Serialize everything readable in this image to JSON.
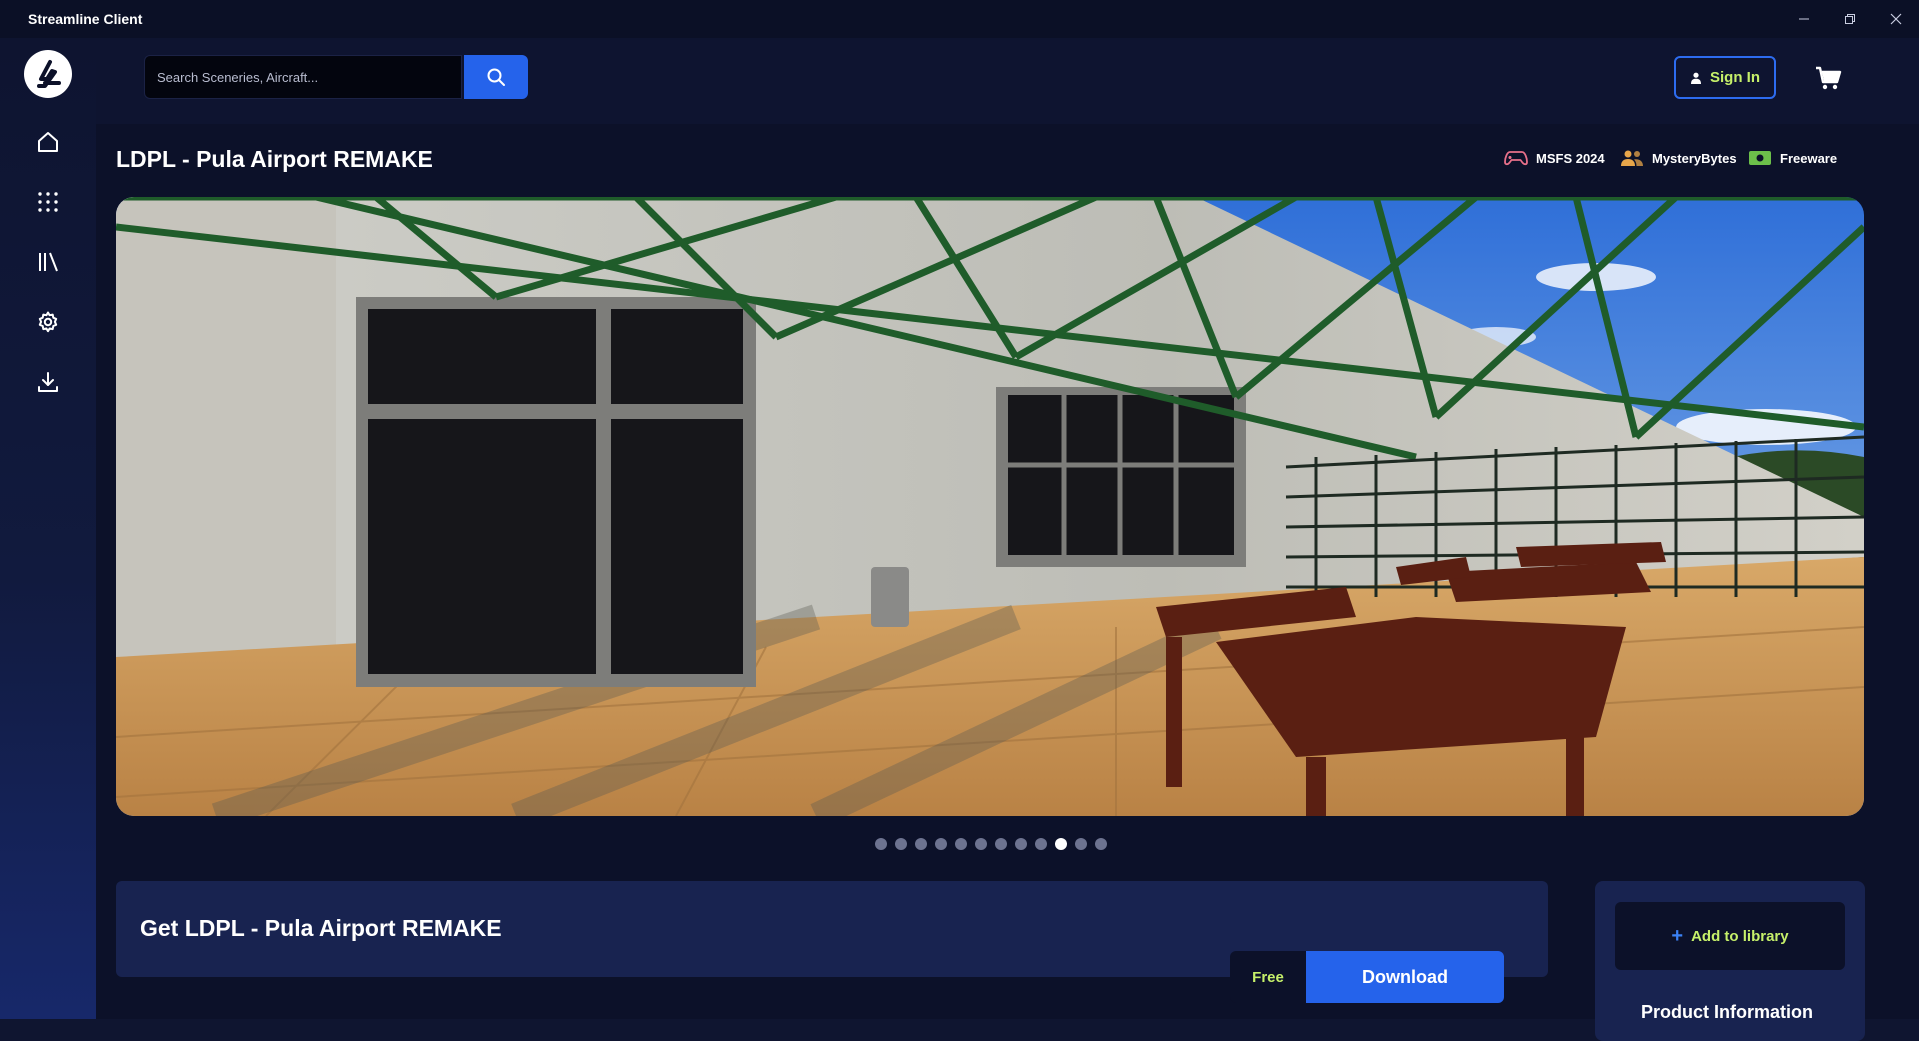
{
  "window": {
    "title": "Streamline Client"
  },
  "search": {
    "placeholder": "Search Sceneries, Aircraft..."
  },
  "header": {
    "sign_in_label": "Sign In"
  },
  "product": {
    "title": "LDPL - Pula Airport REMAKE",
    "platform": "MSFS 2024",
    "developer": "MysteryBytes",
    "license": "Freeware",
    "get_title": "Get LDPL - Pula Airport REMAKE",
    "price": "Free",
    "download_label": "Download",
    "add_to_library_label": "Add to library",
    "info_heading": "Product Information"
  },
  "gallery": {
    "slide_count": 12,
    "active_slide": 10
  },
  "colors": {
    "accent_blue": "#2563eb",
    "accent_lime": "#c6f06a",
    "background": "#0c1129",
    "card": "#182350"
  },
  "icons": {
    "nav": [
      "home-icon",
      "grid-icon",
      "library-icon",
      "settings-icon",
      "download-icon"
    ],
    "search": "search-icon",
    "cart": "cart-icon",
    "user": "user-icon"
  }
}
